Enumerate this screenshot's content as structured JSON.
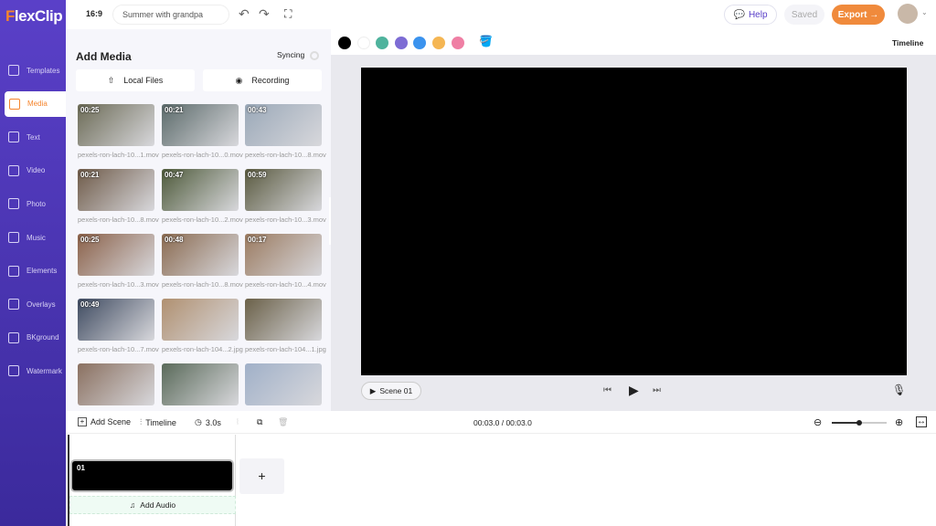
{
  "app": {
    "logo": "FlexClip",
    "aspect": "16:9",
    "project_title": "Summer with grandpa"
  },
  "header": {
    "help": "Help",
    "saved": "Saved",
    "export": "Export →"
  },
  "sidebar": {
    "items": [
      {
        "label": "Templates",
        "active": false
      },
      {
        "label": "Media",
        "active": true
      },
      {
        "label": "Text",
        "active": false
      },
      {
        "label": "Video",
        "active": false
      },
      {
        "label": "Photo",
        "active": false
      },
      {
        "label": "Music",
        "active": false
      },
      {
        "label": "Elements",
        "active": false
      },
      {
        "label": "Overlays",
        "active": false
      },
      {
        "label": "BKground",
        "active": false
      },
      {
        "label": "Watermark",
        "active": false
      }
    ]
  },
  "panel": {
    "title": "Add Media",
    "syncing": "Syncing",
    "local_files": "Local Files",
    "recording": "Recording",
    "items": [
      {
        "duration": "00:25",
        "name": "pexels-ron-lach-10...1.mov",
        "color": "#6b6a55"
      },
      {
        "duration": "00:21",
        "name": "pexels-ron-lach-10...0.mov",
        "color": "#5b6a6a"
      },
      {
        "duration": "00:43",
        "name": "pexels-ron-lach-10...8.mov",
        "color": "#9aa8b8"
      },
      {
        "duration": "00:21",
        "name": "pexels-ron-lach-10...8.mov",
        "color": "#6e5a48"
      },
      {
        "duration": "00:47",
        "name": "pexels-ron-lach-10...2.mov",
        "color": "#4e5a3a"
      },
      {
        "duration": "00:59",
        "name": "pexels-ron-lach-10...3.mov",
        "color": "#5a5a40"
      },
      {
        "duration": "00:25",
        "name": "pexels-ron-lach-10...3.mov",
        "color": "#8a6048"
      },
      {
        "duration": "00:48",
        "name": "pexels-ron-lach-10...8.mov",
        "color": "#8a6a50"
      },
      {
        "duration": "00:17",
        "name": "pexels-ron-lach-10...4.mov",
        "color": "#9a7a60"
      },
      {
        "duration": "00:49",
        "name": "pexels-ron-lach-10...7.mov",
        "color": "#3e4a60"
      },
      {
        "duration": "",
        "name": "pexels-ron-lach-104...2.jpg",
        "color": "#b09070"
      },
      {
        "duration": "",
        "name": "pexels-ron-lach-104...1.jpg",
        "color": "#6a6048"
      },
      {
        "duration": "",
        "name": "",
        "color": "#8a7060"
      },
      {
        "duration": "",
        "name": "",
        "color": "#5a6a5a"
      },
      {
        "duration": "",
        "name": "",
        "color": "#a0b0c8"
      }
    ]
  },
  "colors": [
    "#000000",
    "#ffffff",
    "#4fb39d",
    "#7d6cd4",
    "#3b93ee",
    "#f5b653",
    "#ef7fa4"
  ],
  "right": {
    "timeline_link": "Timeline",
    "scene_label": "Scene 01"
  },
  "timeline": {
    "add_scene": "Add Scene",
    "timeline": "Timeline",
    "duration": "3.0s",
    "time": "00:03.0 / 00:03.0",
    "scene_number": "01",
    "add_audio": "Add Audio",
    "zoom_level": 0.5
  }
}
